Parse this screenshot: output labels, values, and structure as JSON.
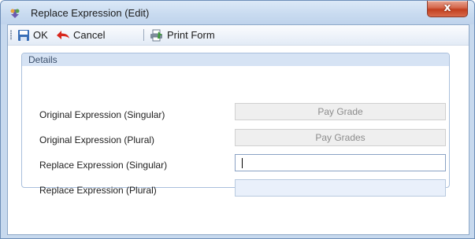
{
  "window": {
    "title": "Replace Expression (Edit)",
    "close_glyph": "x"
  },
  "toolbar": {
    "ok_label": "OK",
    "cancel_label": "Cancel",
    "print_label": "Print Form"
  },
  "details": {
    "title": "Details",
    "rows": [
      {
        "label": "Original Expression (Singular)",
        "value": "Pay Grade",
        "state": "disabled"
      },
      {
        "label": "Original Expression (Plural)",
        "value": "Pay Grades",
        "state": "disabled"
      },
      {
        "label": "Replace Expression (Singular)",
        "value": "",
        "state": "focused"
      },
      {
        "label": "Replace Expression (Plural)",
        "value": "",
        "state": "empty"
      }
    ]
  },
  "colors": {
    "titlebar": "#c9dbf0",
    "group_header": "#d6e3f4",
    "close_button": "#c23f1f"
  },
  "icons": [
    "app-icon",
    "save-icon",
    "cancel-arrow-icon",
    "print-icon",
    "close-icon"
  ]
}
